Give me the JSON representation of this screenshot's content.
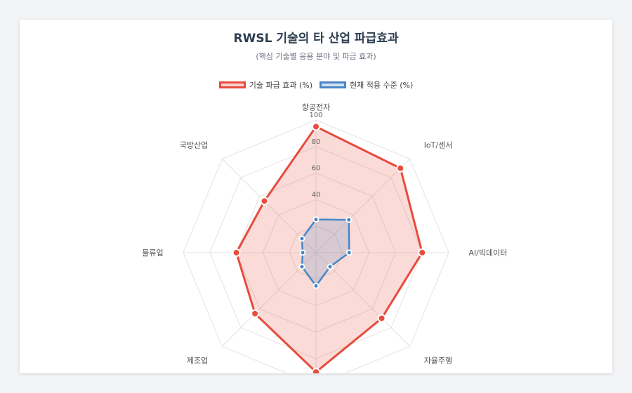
{
  "chart_data": {
    "type": "radar",
    "title": "RWSL 기술의 타 산업 파급효과",
    "subtitle": "(핵심 기술별 응용 분야 및 파급 효과)",
    "axes": [
      "항공전자",
      "IoT/센서",
      "AI/빅데이터",
      "자율주행",
      "",
      "제조업",
      "물류업",
      "국방산업"
    ],
    "rlim": [
      0,
      100
    ],
    "ticks": [
      40,
      60,
      80,
      100
    ],
    "series": [
      {
        "name": "기술 파급 효과 (%)",
        "values": [
          95,
          90,
          80,
          70,
          90,
          65,
          60,
          55
        ],
        "color": "#e74c3c",
        "fill": "rgba(231,76,60,0.2)"
      },
      {
        "name": "현재 적용 수준 (%)",
        "values": [
          25,
          35,
          25,
          15,
          25,
          15,
          10,
          15
        ],
        "color": "#4a86c5",
        "fill": "rgba(74,134,197,0.2)"
      }
    ],
    "legend": "top",
    "grid": true
  }
}
